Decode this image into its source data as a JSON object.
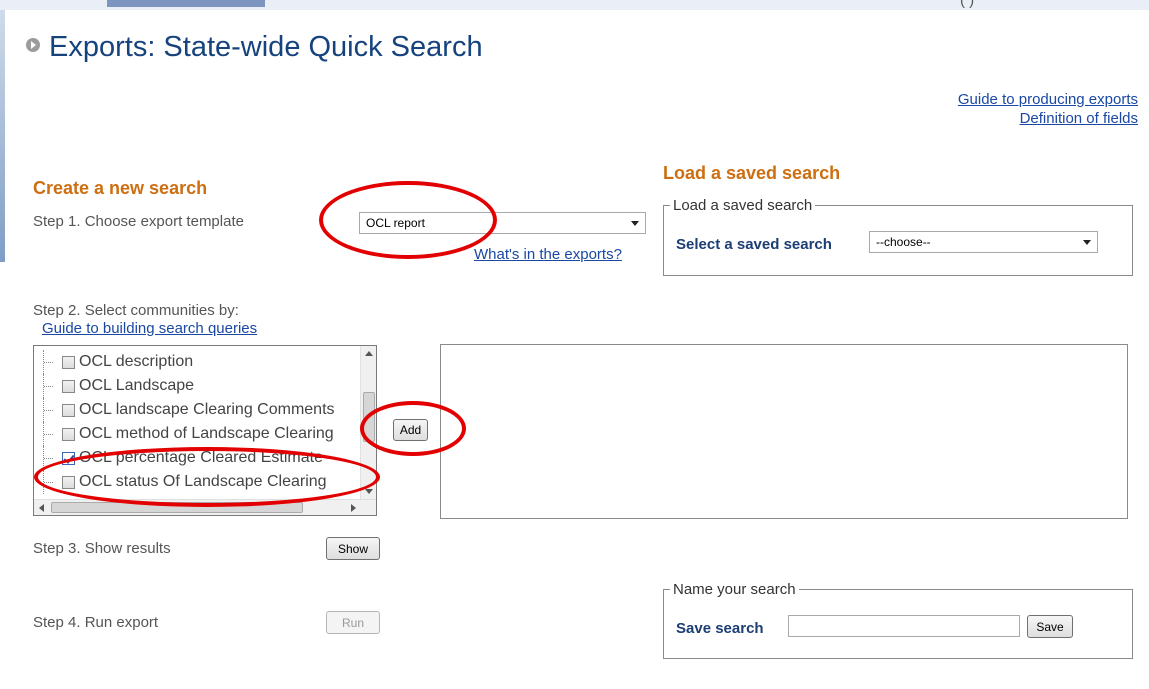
{
  "page": {
    "top_paren": "(                              )",
    "title": "Exports: State-wide Quick Search"
  },
  "guides": {
    "producing_exports": "Guide to producing exports",
    "definition_of_fields": "Definition of fields"
  },
  "create": {
    "heading": "Create a new search",
    "step1_label": "Step 1. Choose export template",
    "template_selected": "OCL report",
    "whats_in_exports": "What's in the exports?",
    "step2_label": "Step 2. Select communities by:",
    "guide_queries": "Guide to building search queries",
    "tree_items": [
      {
        "label": "OCL description",
        "checked": false
      },
      {
        "label": "OCL Landscape",
        "checked": false
      },
      {
        "label": "OCL landscape Clearing Comments",
        "checked": false
      },
      {
        "label": "OCL method of Landscape Clearing",
        "checked": false
      },
      {
        "label": "OCL percentage Cleared Estimate",
        "checked": true
      },
      {
        "label": "OCL status Of Landscape Clearing",
        "checked": false
      }
    ],
    "add_button": "Add",
    "step3_label": "Step 3. Show results",
    "show_button": "Show",
    "step4_label": "Step 4. Run export",
    "run_button": "Run"
  },
  "load": {
    "heading": "Load a saved search",
    "legend": "Load a saved search",
    "select_label": "Select a saved search",
    "select_value": "--choose--"
  },
  "save": {
    "legend": "Name your search",
    "label": "Save search",
    "input_value": "",
    "button": "Save"
  },
  "colors": {
    "title": "#16437e",
    "section_heading": "#cd6f11",
    "link": "#1a48a3",
    "annotation_ring": "#e30000"
  }
}
